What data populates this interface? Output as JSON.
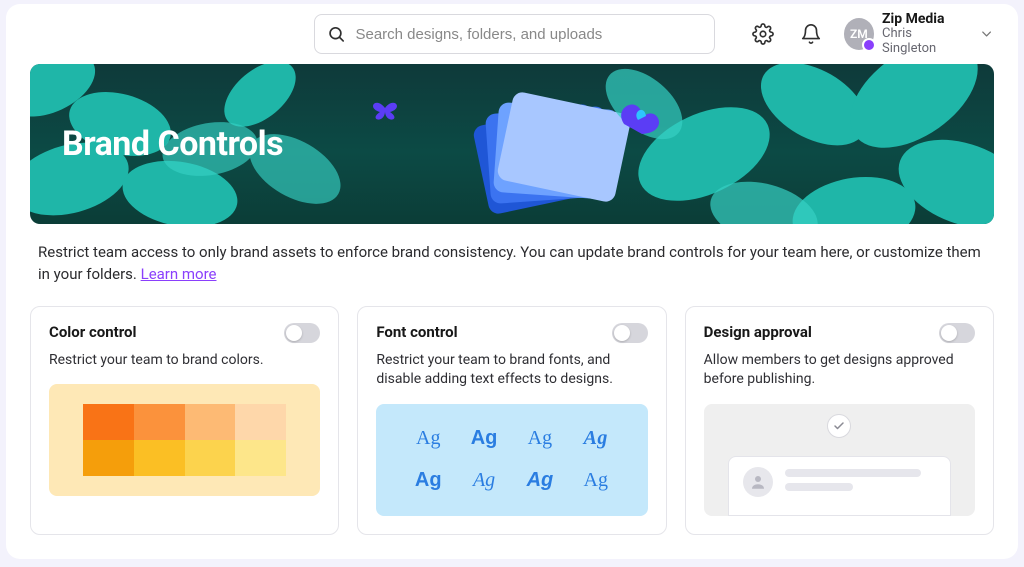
{
  "search": {
    "placeholder": "Search designs, folders, and uploads"
  },
  "org": {
    "name": "Zip Media",
    "user": "Chris Singleton",
    "initials": "ZM"
  },
  "banner": {
    "title": "Brand Controls"
  },
  "intro": {
    "text": "Restrict team access to only brand assets to enforce brand consistency. You can update brand controls for your team here, or customize them in your folders. ",
    "learn_more": "Learn more"
  },
  "cards": {
    "color": {
      "title": "Color control",
      "desc": "Restrict your team to brand colors.",
      "toggle": false,
      "swatches": [
        "#f97316",
        "#fb923c",
        "#fdba74",
        "#fed7aa",
        "#f59e0b",
        "#fbbf24",
        "#fcd34d",
        "#fde68a"
      ]
    },
    "font": {
      "title": "Font control",
      "desc": "Restrict your team to brand fonts, and disable adding text effects to designs.",
      "toggle": false,
      "sample": "Ag"
    },
    "approval": {
      "title": "Design approval",
      "desc": "Allow members to get designs approved before publishing.",
      "toggle": false
    }
  }
}
